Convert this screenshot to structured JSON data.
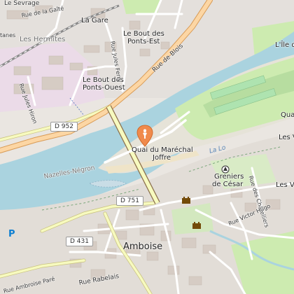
{
  "map": {
    "place_labels": {
      "le_sevrage": "Le Sevrage",
      "rue_de_la_gaite": "Rue de la Gaîté",
      "la_gare": "La Gare",
      "les_hermites": "Les Hermites",
      "tanes": "tanes",
      "bout_ponts_est_1": "Le Bout des",
      "bout_ponts_est_2": "Ponts-Est",
      "bout_ponts_ouest_1": "Le Bout des",
      "bout_ponts_ouest_2": "Ponts-Ouest",
      "ile_d": "L'Île d",
      "rue_de_blois": "Rue de Blois",
      "rue_jules_ferry": "Rue Jules Ferry",
      "rue_jules_hiron": "Rue Jules Hiron",
      "d952": "D 952",
      "quai_1": "Quai du Maréchal",
      "quai_2": "Joffre",
      "la_loire": "La Lo",
      "quai_right": "Qua",
      "les_vi_1": "Les Vi",
      "les_vi_2": "Les Vic",
      "nazelles": "Nazelles-Négron",
      "greniers_1": "Greniers",
      "greniers_2": "de César",
      "rue_chatelliers": "Rue des Châtelliers",
      "d751": "D 751",
      "rue_victor_hugo": "Rue Victor Hugo",
      "d431": "D 431",
      "amboise": "Amboise",
      "rue_ambroise_pare": "Rue Ambroise Paré",
      "rue_rabelais": "Rue Rabelais",
      "parking": "P"
    },
    "colors": {
      "water": "#aad3df",
      "marker": "#f08a4b",
      "primary_road": "#fcd6a4",
      "secondary_road": "#f7fabf",
      "park": "#c8facc",
      "industrial": "#ebdbe8"
    },
    "icons": {
      "marker": "map-pin-icon",
      "monument_1": "castle-icon",
      "monument_2": "castle-icon",
      "viewpoint": "viewpoint-icon",
      "parking": "parking-icon"
    }
  }
}
